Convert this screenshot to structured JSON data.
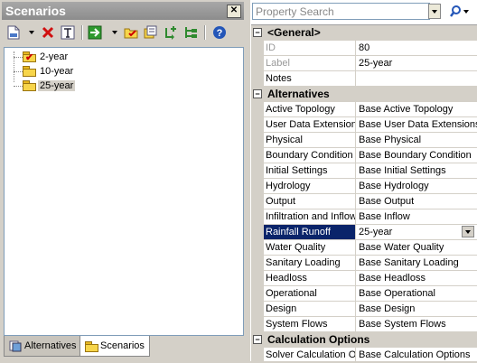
{
  "scenarios_panel": {
    "title": "Scenarios",
    "close_glyph": "✕",
    "tree": [
      {
        "label": "2-year",
        "checked": true
      },
      {
        "label": "10-year",
        "checked": false
      },
      {
        "label": "25-year",
        "checked": false,
        "selected": true
      }
    ],
    "tabs": [
      {
        "label": "Alternatives",
        "active": false
      },
      {
        "label": "Scenarios",
        "active": true
      }
    ]
  },
  "property_panel": {
    "search_placeholder": "Property Search",
    "sections": [
      {
        "title": "<General>",
        "rows": [
          {
            "name": "ID",
            "value": "80",
            "disabled": true
          },
          {
            "name": "Label",
            "value": "25-year",
            "disabled": true
          },
          {
            "name": "Notes",
            "value": ""
          }
        ]
      },
      {
        "title": "Alternatives",
        "rows": [
          {
            "name": "Active Topology",
            "value": "Base Active Topology"
          },
          {
            "name": "User Data Extensions",
            "value": "Base User Data Extensions"
          },
          {
            "name": "Physical",
            "value": "Base Physical"
          },
          {
            "name": "Boundary Condition",
            "value": "Base Boundary Condition"
          },
          {
            "name": "Initial Settings",
            "value": "Base Initial Settings"
          },
          {
            "name": "Hydrology",
            "value": "Base Hydrology"
          },
          {
            "name": "Output",
            "value": "Base Output"
          },
          {
            "name": "Infiltration and Inflow",
            "value": "Base Inflow"
          },
          {
            "name": "Rainfall Runoff",
            "value": "25-year",
            "selected": true
          },
          {
            "name": "Water Quality",
            "value": "Base Water Quality"
          },
          {
            "name": "Sanitary Loading",
            "value": "Base Sanitary Loading"
          },
          {
            "name": "Headloss",
            "value": "Base Headloss"
          },
          {
            "name": "Operational",
            "value": "Base Operational"
          },
          {
            "name": "Design",
            "value": "Base Design"
          },
          {
            "name": "System Flows",
            "value": "Base System Flows"
          }
        ]
      },
      {
        "title": "Calculation Options",
        "rows": [
          {
            "name": "Solver Calculation Options",
            "value": "Base Calculation Options"
          }
        ]
      }
    ]
  },
  "colors": {
    "selection": "#0a246a",
    "panel_bg": "#d4d0c8"
  }
}
